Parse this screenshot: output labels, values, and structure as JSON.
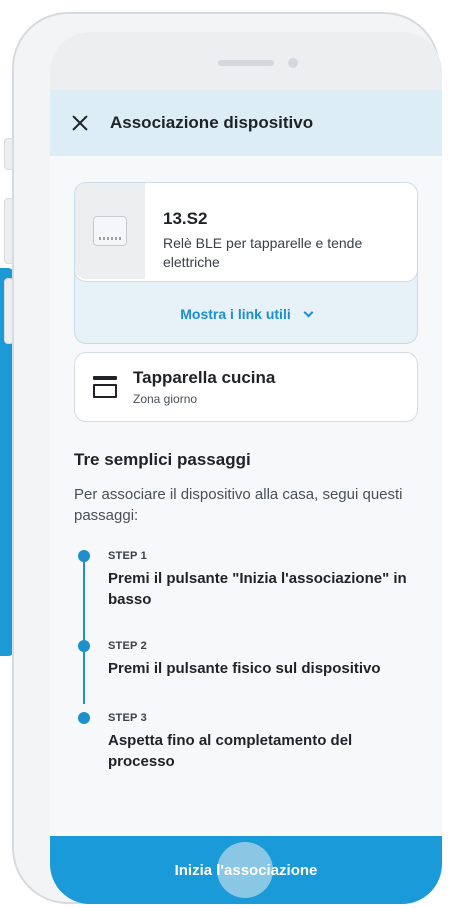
{
  "header": {
    "title": "Associazione dispositivo",
    "close_icon": "close-icon"
  },
  "device": {
    "model": "13.S2",
    "description": "Relè BLE per tapparelle e tende elettriche",
    "links_label": "Mostra i link utili",
    "links_icon": "chevron-down-icon"
  },
  "room": {
    "icon": "blind-icon",
    "name": "Tapparella cucina",
    "zone": "Zona giorno"
  },
  "steps_section": {
    "title": "Tre semplici passaggi",
    "intro": "Per associare il dispositivo alla casa, segui questi passaggi:",
    "steps": [
      {
        "label": "STEP 1",
        "text": "Premi il pulsante \"Inizia l'associazione\" in basso"
      },
      {
        "label": "STEP 2",
        "text": "Premi il pulsante fisico sul dispositivo"
      },
      {
        "label": "STEP 3",
        "text": "Aspetta fino al completamento del processo"
      }
    ]
  },
  "cta": {
    "label": "Inizia l'associazione"
  },
  "colors": {
    "accent": "#1d8fcc",
    "button": "#1a9ad8",
    "header_bg": "#dcedf5"
  }
}
